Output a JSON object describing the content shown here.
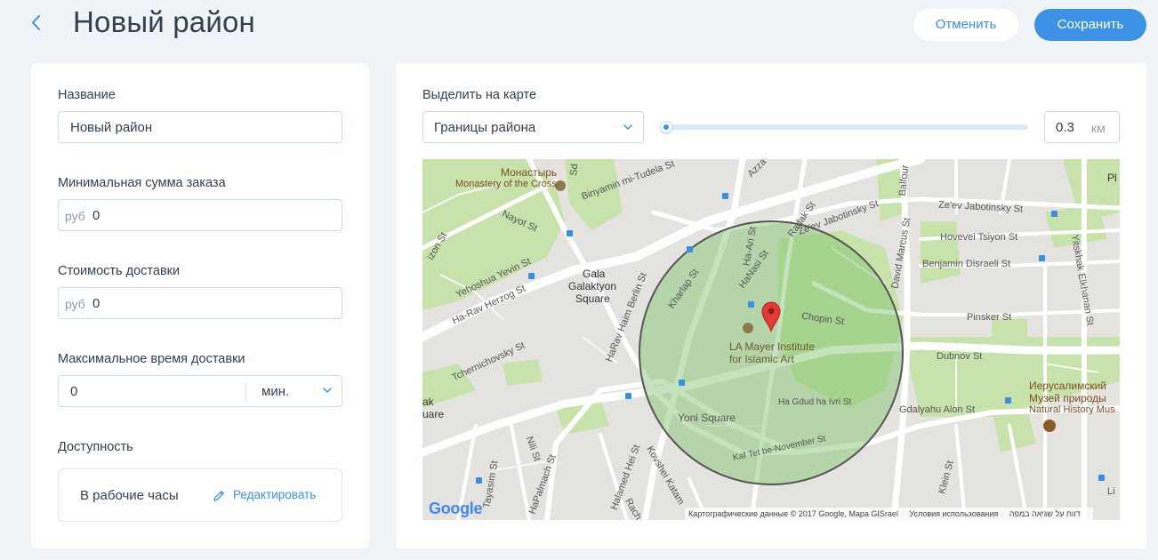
{
  "header": {
    "title": "Новый район",
    "cancel_label": "Отменить",
    "save_label": "Сохранить"
  },
  "form": {
    "name_label": "Название",
    "name_value": "Новый район",
    "min_order_label": "Минимальная сумма заказа",
    "min_order_currency": "руб",
    "min_order_value": "0",
    "delivery_cost_label": "Стоимость доставки",
    "delivery_cost_currency": "руб",
    "delivery_cost_value": "0",
    "max_time_label": "Максимальное время доставки",
    "max_time_value": "0",
    "max_time_unit": "мин.",
    "availability_label": "Доступность",
    "availability_value": "В рабочие часы",
    "edit_label": "Редактировать"
  },
  "map_panel": {
    "select_label": "Выделить на карте",
    "select_value": "Границы района",
    "radius_value": "0.3",
    "radius_unit": "км",
    "slider_fraction": 0.0,
    "attribution": {
      "data": "Картографические данные © 2017 Google, Mapa GISrael",
      "terms": "Условия использования",
      "report": "דווח על שגיאה במפה"
    },
    "google_logo": "Google",
    "place_labels": {
      "monastery_ru": "Монастырь",
      "monastery_en": "Monastery of the Cross",
      "gala_1": "Gala",
      "gala_2": "Galaktyon",
      "gala_3": "Square",
      "la_mayer_1": "LA Mayer Institute",
      "la_mayer_2": "for Islamic Art",
      "yoni": "Yoni Square",
      "museum_1": "Иерусалимский",
      "museum_2": "Музей природы",
      "museum_3": "Natural History Mus",
      "pl": "Pl",
      "ak": "ak",
      "uare": "uare",
      "li": "Li"
    },
    "street_labels": {
      "binyamin": "Binyamin mi-Tudela St",
      "azza": "Azza",
      "nayot": "Nayot St",
      "izon": "izon St",
      "yehoshua": "Yehoshua Yevin St",
      "herzog": "Ha-Rav Herzog St",
      "tchernichovsky": "Tchernichovsky St",
      "harav_berlin": "HaRav Haim Berlin St",
      "kharlap": "Kharlap St",
      "hanasi": "HaNasi St",
      "haari": "Ha-Ari St",
      "radak": "Radak St",
      "jabotinsky1": "Ze'ev Jabotinsky St",
      "jabotinsky2": "Ze'ev Jabotinsky St",
      "tsiyon": "Hovevei Tsiyon St",
      "disraeli": "Benjamin Disraeli St",
      "pinsker": "Pinsker St",
      "chopin": "Chopin St",
      "dubnov": "Dubnov St",
      "gdud": "Ha Gdud ha Ivri St",
      "alon": "Gdalyahu Alon St",
      "kaftet": "Kaf Tet be-November St",
      "nili": "Nili St",
      "tayasim": "Tayasim St",
      "palmach": "HaPalmach St",
      "halamed": "Halamed Hei St",
      "kovshei": "Kovshei Katam",
      "rach": "Rach",
      "marcus": "David Marcus St",
      "balfour": "Balfour",
      "elkhanan": "Yitskhak Elkhanan St",
      "klein": "Klein St",
      "sd": "Sd"
    }
  }
}
